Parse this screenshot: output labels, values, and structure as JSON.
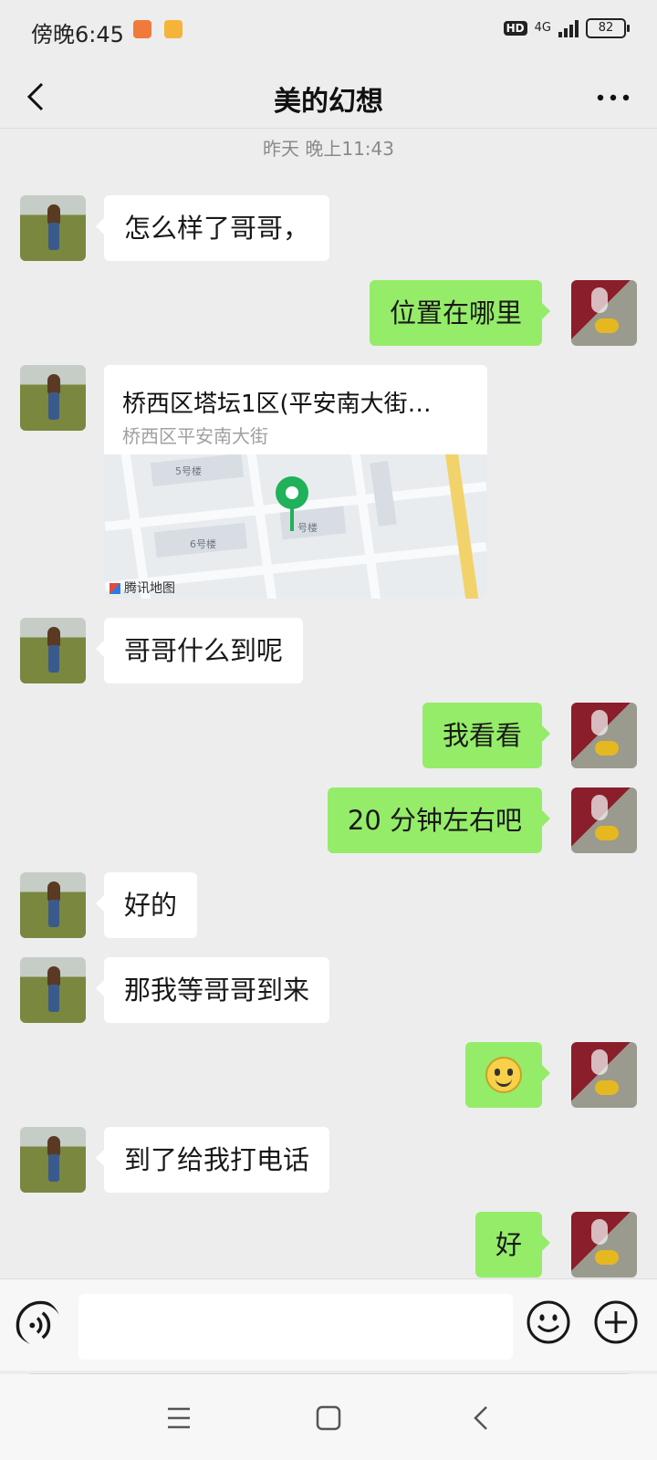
{
  "status_bar": {
    "time": "傍晚6:45",
    "hd": "HD",
    "network": "4G",
    "battery": "82"
  },
  "header": {
    "title": "美的幻想"
  },
  "chat": {
    "timestamp": "昨天 晚上11:43",
    "messages": [
      {
        "from": "them",
        "text": "怎么样了哥哥，"
      },
      {
        "from": "me",
        "text": "位置在哪里"
      },
      {
        "from": "them",
        "type": "location",
        "title": "桥西区塔坛1区(平安南大街…",
        "subtitle": "桥西区平安南大街",
        "map_labels": [
          "5号楼",
          "6号楼",
          "号楼"
        ],
        "map_brand": "腾讯地图"
      },
      {
        "from": "them",
        "text": "哥哥什么到呢"
      },
      {
        "from": "me",
        "text": "我看看"
      },
      {
        "from": "me",
        "text": "20 分钟左右吧"
      },
      {
        "from": "them",
        "text": "好的"
      },
      {
        "from": "them",
        "text": "那我等哥哥到来"
      },
      {
        "from": "me",
        "type": "emoji",
        "emoji": "smile-emoji"
      },
      {
        "from": "them",
        "text": "到了给我打电话"
      },
      {
        "from": "me",
        "text": "好"
      }
    ]
  },
  "input_bar": {
    "value": "",
    "placeholder": ""
  },
  "colors": {
    "background": "#ededed",
    "outgoing_bubble": "#95ec69",
    "incoming_bubble": "#ffffff",
    "map_pin": "#20b15a"
  }
}
